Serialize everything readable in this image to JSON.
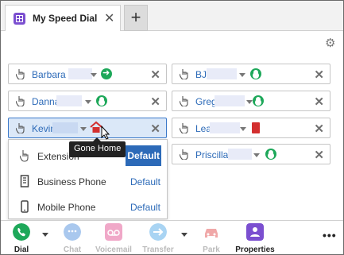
{
  "tab": {
    "title": "My Speed Dial",
    "close": "✕",
    "add": "+"
  },
  "settings_icon": "gear-icon",
  "entries": [
    {
      "name": "Barbara",
      "status": "forwarding",
      "status_color": "#1ea85a"
    },
    {
      "name": "BJ",
      "status": "available",
      "status_color": "#1ea85a"
    },
    {
      "name": "Danna",
      "status": "available",
      "status_color": "#1ea85a"
    },
    {
      "name": "Greg",
      "status": "available",
      "status_color": "#1ea85a"
    },
    {
      "name": "Kevin",
      "status": "gone-home",
      "status_color": "#d32f2f"
    },
    {
      "name": "Lea",
      "status": "busy",
      "status_color": "#d32f2f"
    },
    {
      "name": "Priscilla",
      "status": "available",
      "status_color": "#1ea85a"
    }
  ],
  "remove_glyph": "✕",
  "tooltip": "Gone Home",
  "menu": {
    "items": [
      {
        "label": "Extension",
        "default": "Default",
        "selected": true
      },
      {
        "label": "Business Phone",
        "default": "Default",
        "selected": false
      },
      {
        "label": "Mobile Phone",
        "default": "Default",
        "selected": false
      }
    ]
  },
  "toolbar": {
    "dial": "Dial",
    "chat": "Chat",
    "voicemail": "Voicemail",
    "transfer": "Transfer",
    "park": "Park",
    "properties": "Properties",
    "more": "•••"
  },
  "colors": {
    "accent": "#2c6ab8",
    "dial": "#1ea85a",
    "properties": "#7b4fd0"
  }
}
